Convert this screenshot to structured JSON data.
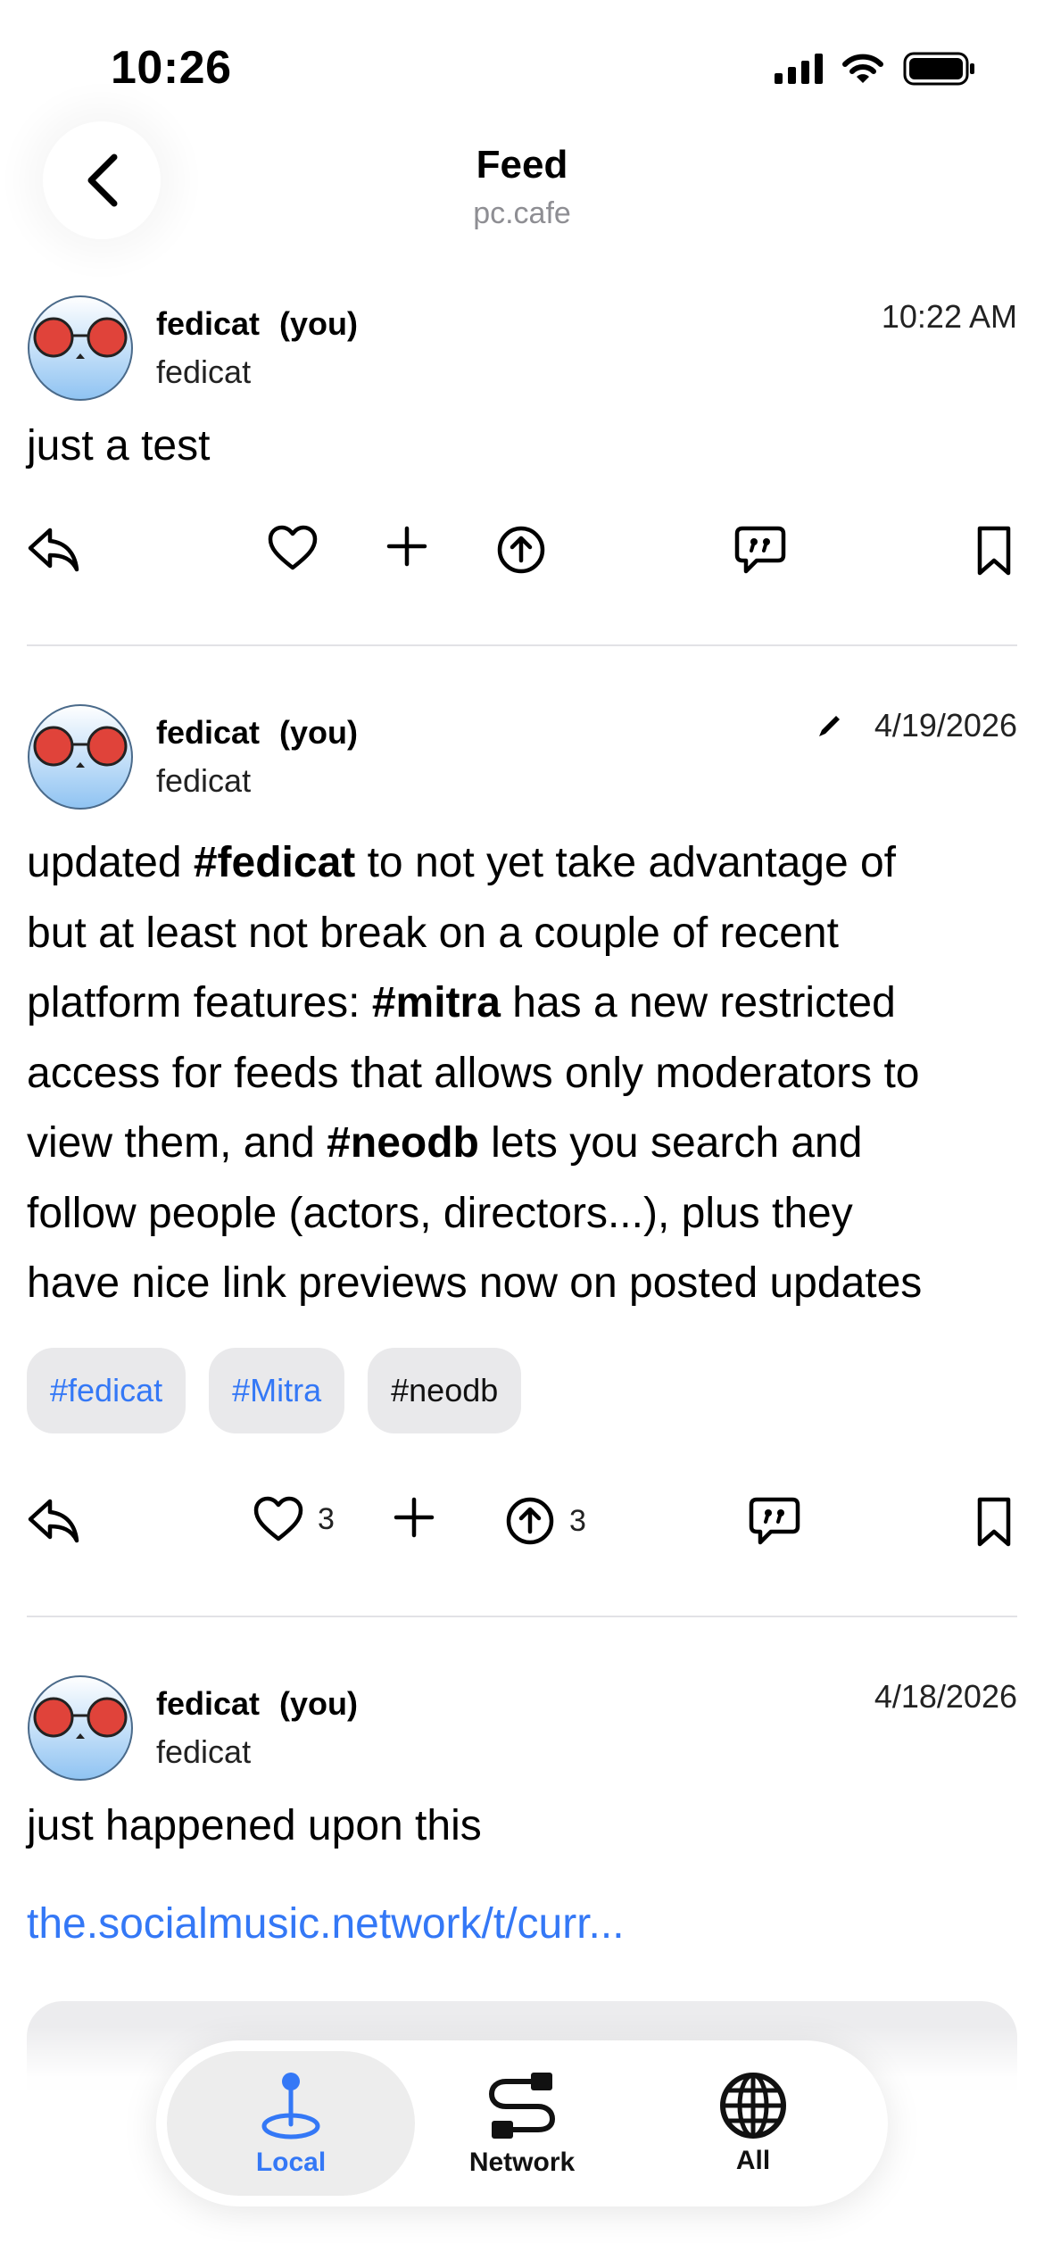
{
  "status_bar": {
    "time": "10:26"
  },
  "nav": {
    "title": "Feed",
    "subtitle": "pc.cafe"
  },
  "posts": [
    {
      "author": "fedicat",
      "you_label": "(you)",
      "handle": "fedicat",
      "time": "10:22 AM",
      "text": "just a test"
    },
    {
      "author": "fedicat",
      "you_label": "(you)",
      "handle": "fedicat",
      "time": "4/19/2026",
      "edited": true,
      "lines": [
        [
          "updated ",
          "#fedicat",
          " to not yet take advantage of"
        ],
        [
          "but at least not break on a couple of recent"
        ],
        [
          "platform features: ",
          "#mitra",
          " has a new restricted"
        ],
        [
          "access for feeds that allows only moderators to"
        ],
        [
          "view them, and ",
          "#neodb",
          " lets you search and"
        ],
        [
          "follow people (actors, directors...), plus they"
        ],
        [
          "have nice link previews now on posted updates"
        ]
      ],
      "tags": [
        "#fedicat",
        "#Mitra",
        "#neodb"
      ],
      "likes": "3",
      "boosts": "3"
    },
    {
      "author": "fedicat",
      "you_label": "(you)",
      "handle": "fedicat",
      "time": "4/18/2026",
      "text": "just happened upon this",
      "link": "the.socialmusic.network/t/curr..."
    }
  ],
  "tabs": [
    {
      "label": "Local",
      "icon": "location-pin-icon",
      "active": true
    },
    {
      "label": "Network",
      "icon": "network-route-icon",
      "active": false
    },
    {
      "label": "All",
      "icon": "globe-icon",
      "active": false
    }
  ],
  "colors": {
    "accent": "#3478f6",
    "tag_bg": "#e9e9eb",
    "divider": "#e2e2e6"
  }
}
